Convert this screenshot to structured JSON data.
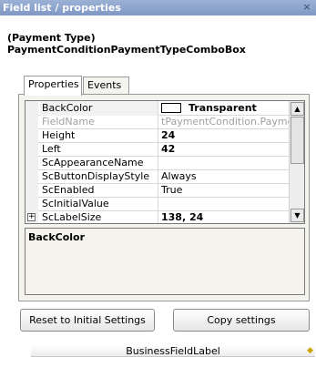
{
  "window": {
    "title": "Field list / properties",
    "close_glyph": "×"
  },
  "header": {
    "line1": "(Payment Type)",
    "line2": "PaymentConditionPaymentTypeComboBox"
  },
  "tabs": [
    {
      "label": "Properties",
      "active": true
    },
    {
      "label": "Events",
      "active": false
    }
  ],
  "grid": {
    "rows": [
      {
        "name": "BackColor",
        "value": "Transparent",
        "style": "bold",
        "swatch": true,
        "selected": true
      },
      {
        "name": "FieldName",
        "value": "tPaymentCondition.PaymentC",
        "style": "gray"
      },
      {
        "name": "Height",
        "value": "24",
        "style": "bold"
      },
      {
        "name": "Left",
        "value": "42",
        "style": "bold"
      },
      {
        "name": "ScAppearanceName",
        "value": ""
      },
      {
        "name": "ScButtonDisplayStyle",
        "value": "Always"
      },
      {
        "name": "ScEnabled",
        "value": "True"
      },
      {
        "name": "ScInitialValue",
        "value": ""
      },
      {
        "name": "ScLabelSize",
        "value": "138, 24",
        "style": "bold",
        "expandable": true
      }
    ],
    "scroll_up_glyph": "▲",
    "scroll_down_glyph": "▼",
    "expand_glyph": "+"
  },
  "description": {
    "title": "BackColor"
  },
  "buttons": {
    "reset_label": "Reset to Initial Settings",
    "copy_label": "Copy settings"
  },
  "field_label": {
    "text": "BusinessFieldLabel",
    "marker_glyph": "◆"
  },
  "colors": {
    "titlebar": "#8ea5cf",
    "panel_bg": "#f4f3ee",
    "marker": "#caa400"
  }
}
